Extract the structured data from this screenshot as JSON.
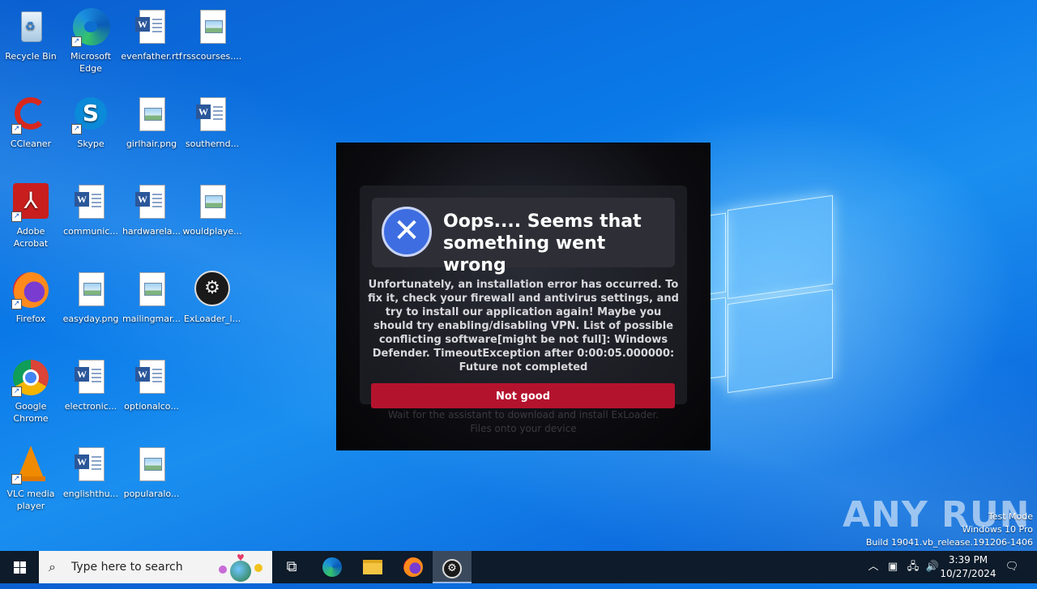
{
  "desktop": {
    "icons": [
      {
        "label": "Recycle Bin",
        "icon": "recycle-bin-icon"
      },
      {
        "label": "Microsoft Edge",
        "icon": "edge-icon"
      },
      {
        "label": "evenfather.rtf",
        "icon": "word-doc-icon"
      },
      {
        "label": "rsscourses....",
        "icon": "image-file-icon"
      },
      {
        "label": "CCleaner",
        "icon": "ccleaner-icon"
      },
      {
        "label": "Skype",
        "icon": "skype-icon"
      },
      {
        "label": "girlhair.png",
        "icon": "image-file-icon"
      },
      {
        "label": "southernd...",
        "icon": "word-doc-icon"
      },
      {
        "label": "Adobe Acrobat",
        "icon": "acrobat-icon"
      },
      {
        "label": "communic...",
        "icon": "word-doc-icon"
      },
      {
        "label": "hardwarela...",
        "icon": "word-doc-icon"
      },
      {
        "label": "wouldplaye...",
        "icon": "image-file-icon"
      },
      {
        "label": "Firefox",
        "icon": "firefox-icon"
      },
      {
        "label": "easyday.png",
        "icon": "image-file-icon"
      },
      {
        "label": "mailingmar...",
        "icon": "image-file-icon"
      },
      {
        "label": "ExLoader_l...",
        "icon": "exloader-icon"
      },
      {
        "label": "Google Chrome",
        "icon": "chrome-icon"
      },
      {
        "label": "electronic...",
        "icon": "word-doc-icon"
      },
      {
        "label": "optionalco...",
        "icon": "word-doc-icon"
      },
      {
        "label": "VLC media player",
        "icon": "vlc-icon"
      },
      {
        "label": "englishthu...",
        "icon": "word-doc-icon"
      },
      {
        "label": "popularalo...",
        "icon": "image-file-icon"
      }
    ]
  },
  "dialog": {
    "title": "Oops.... Seems that something went wrong",
    "message": "Unfortunately, an installation error has occurred. To fix it, check your firewall and antivirus settings, and try to install our application again! Maybe you should try enabling/disabling VPN. List of possible conflicting software[might be not full]: Windows Defender. TimeoutException after 0:00:05.000000: Future not completed",
    "button_label": "Not good",
    "background_text": "Wait for the assistant to download and install ExLoader. Files onto your device"
  },
  "watermark": {
    "brand": "ANY RUN",
    "line1": "Test Mode",
    "line2": "Windows 10 Pro",
    "line3": "Build 19041.vb_release.191206-1406"
  },
  "taskbar": {
    "search_placeholder": "Type here to search",
    "time": "3:39 PM",
    "date": "10/27/2024"
  },
  "colors": {
    "button_red": "#b4132e",
    "error_icon_blue": "#3d6de0",
    "desktop_blue": "#0a79e8"
  }
}
